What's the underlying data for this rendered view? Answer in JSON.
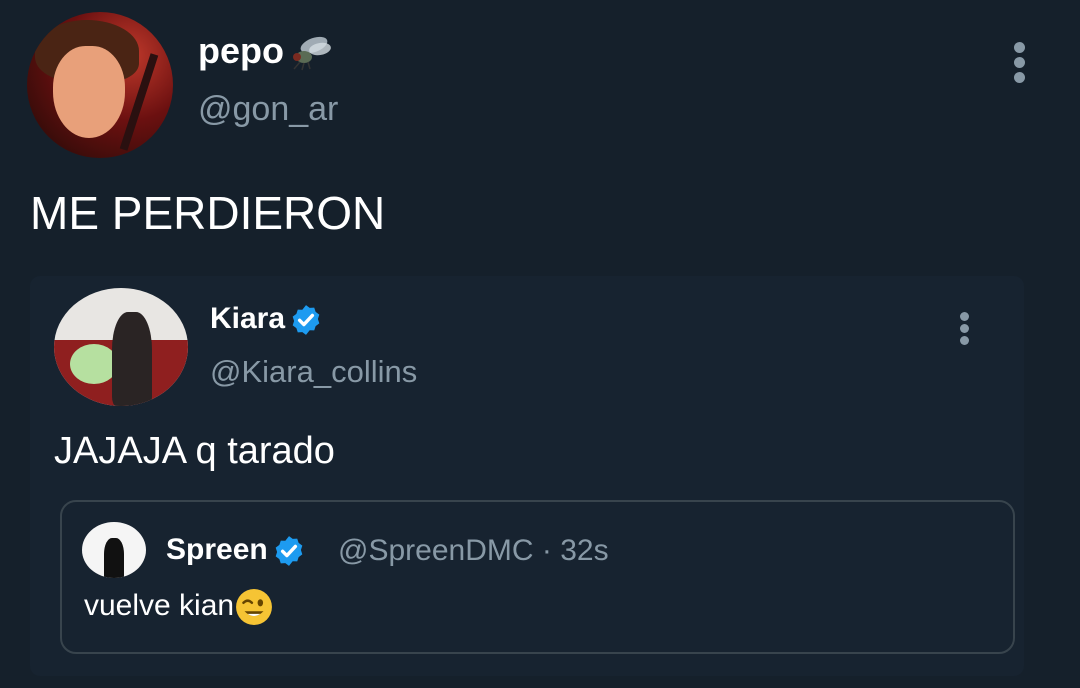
{
  "tweet": {
    "author_name": "pepo",
    "author_name_emoji": "fly-emoji",
    "author_handle": "@gon_ar",
    "text": "ME PERDIERON"
  },
  "quoted_tweet": {
    "author_name": "Kiara",
    "author_handle": "@Kiara_collins",
    "verified": true,
    "text": "JAJAJA q tarado"
  },
  "nested_quote": {
    "author_name": "Spreen",
    "verified": true,
    "author_handle": "@SpreenDMC",
    "separator": "·",
    "time": "32s",
    "text": "vuelve kian",
    "text_emoji": "winking-face-emoji"
  },
  "colors": {
    "background": "#15202b",
    "secondary_text": "#8899a6",
    "verified_badge": "#1d9bf0",
    "card_border": "#38444d"
  }
}
